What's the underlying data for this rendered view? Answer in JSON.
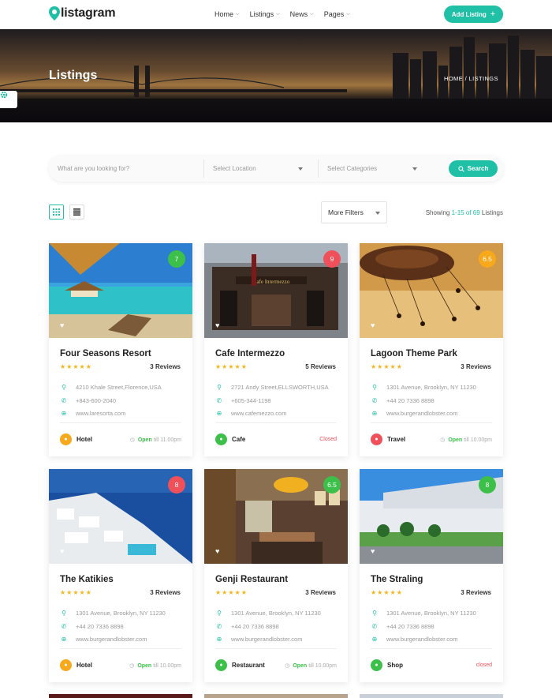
{
  "brand": {
    "name": "listagram",
    "accent": "#1fc0a6"
  },
  "nav": [
    {
      "label": "Home"
    },
    {
      "label": "Listings"
    },
    {
      "label": "News"
    },
    {
      "label": "Pages"
    }
  ],
  "header": {
    "add_listing_label": "Add Listing",
    "add_icon": "plus-icon"
  },
  "hero": {
    "title": "Listings",
    "breadcrumb": "HOME / LISTINGS"
  },
  "search": {
    "keyword_placeholder": "What are you looking for?",
    "location_placeholder": "Select Location",
    "category_placeholder": "Select Categories",
    "button_label": "Search"
  },
  "toolbar": {
    "more_filters_label": "More Filters",
    "showing_prefix": "Showing ",
    "showing_range": "1-15 of 69",
    "showing_suffix": " Listings"
  },
  "listings": [
    {
      "name": "Four Seasons Resort",
      "rating": "7",
      "rating_color": "#3cc04a",
      "reviews": "3 Reviews",
      "address": "4210 Khale Street,Florence,USA",
      "phone": "+843-600-2040",
      "website": "www.laresorta.com",
      "category": "Hotel",
      "category_color": "#f7a81b",
      "status_word": "Open",
      "status_rest": "till 11.00pm"
    },
    {
      "name": "Cafe Intermezzo",
      "rating": "9",
      "rating_color": "#f0505a",
      "reviews": "5 Reviews",
      "address": "2721 Andy Street,ELLSWORTH,USA",
      "phone": "+605-344-1198",
      "website": "www.cafemezzo.com",
      "category": "Cafe",
      "category_color": "#3cc04a",
      "status_word": "",
      "status_rest": "Closed"
    },
    {
      "name": "Lagoon Theme Park",
      "rating": "6.5",
      "rating_color": "#f7a81b",
      "reviews": "3 Reviews",
      "address": "1301 Avenue, Brooklyn, NY 11230",
      "phone": "+44 20 7336 8898",
      "website": "www.burgerandlobster.com",
      "category": "Travel",
      "category_color": "#f0505a",
      "status_word": "Open",
      "status_rest": "till 10.00pm"
    },
    {
      "name": "The Katikies",
      "rating": "8",
      "rating_color": "#f0505a",
      "reviews": "3 Reviews",
      "address": "1301 Avenue, Brooklyn, NY 11230",
      "phone": "+44 20 7336 8898",
      "website": "www.burgerandlobster.com",
      "category": "Hotel",
      "category_color": "#f7a81b",
      "status_word": "Open",
      "status_rest": "till 10.00pm"
    },
    {
      "name": "Genji Restaurant",
      "rating": "6.5",
      "rating_color": "#3cc04a",
      "reviews": "3 Reviews",
      "address": "1301 Avenue, Brooklyn, NY 11230",
      "phone": "+44 20 7336 8898",
      "website": "www.burgerandlobster.com",
      "category": "Restaurant",
      "category_color": "#3cc04a",
      "status_word": "Open",
      "status_rest": "till 10.00pm"
    },
    {
      "name": "The Straling",
      "rating": "8",
      "rating_color": "#3cc04a",
      "reviews": "3 Reviews",
      "address": "1301 Avenue, Brooklyn, NY 11230",
      "phone": "+44 20 7336 8898",
      "website": "www.burgerandlobster.com",
      "category": "Shop",
      "category_color": "#3cc04a",
      "status_word": "",
      "status_rest": "closed"
    }
  ]
}
